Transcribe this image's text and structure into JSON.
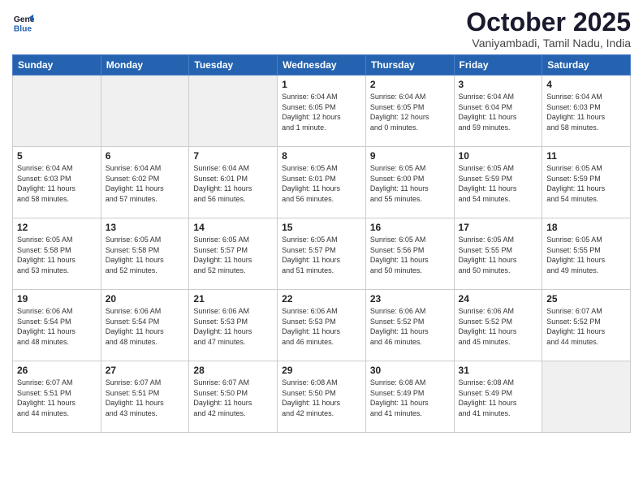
{
  "logo": {
    "line1": "General",
    "line2": "Blue"
  },
  "header": {
    "title": "October 2025",
    "subtitle": "Vaniyambadi, Tamil Nadu, India"
  },
  "weekdays": [
    "Sunday",
    "Monday",
    "Tuesday",
    "Wednesday",
    "Thursday",
    "Friday",
    "Saturday"
  ],
  "weeks": [
    [
      {
        "day": "",
        "info": "",
        "empty": true
      },
      {
        "day": "",
        "info": "",
        "empty": true
      },
      {
        "day": "",
        "info": "",
        "empty": true
      },
      {
        "day": "1",
        "info": "Sunrise: 6:04 AM\nSunset: 6:05 PM\nDaylight: 12 hours\nand 1 minute."
      },
      {
        "day": "2",
        "info": "Sunrise: 6:04 AM\nSunset: 6:05 PM\nDaylight: 12 hours\nand 0 minutes."
      },
      {
        "day": "3",
        "info": "Sunrise: 6:04 AM\nSunset: 6:04 PM\nDaylight: 11 hours\nand 59 minutes."
      },
      {
        "day": "4",
        "info": "Sunrise: 6:04 AM\nSunset: 6:03 PM\nDaylight: 11 hours\nand 58 minutes."
      }
    ],
    [
      {
        "day": "5",
        "info": "Sunrise: 6:04 AM\nSunset: 6:03 PM\nDaylight: 11 hours\nand 58 minutes."
      },
      {
        "day": "6",
        "info": "Sunrise: 6:04 AM\nSunset: 6:02 PM\nDaylight: 11 hours\nand 57 minutes."
      },
      {
        "day": "7",
        "info": "Sunrise: 6:04 AM\nSunset: 6:01 PM\nDaylight: 11 hours\nand 56 minutes."
      },
      {
        "day": "8",
        "info": "Sunrise: 6:05 AM\nSunset: 6:01 PM\nDaylight: 11 hours\nand 56 minutes."
      },
      {
        "day": "9",
        "info": "Sunrise: 6:05 AM\nSunset: 6:00 PM\nDaylight: 11 hours\nand 55 minutes."
      },
      {
        "day": "10",
        "info": "Sunrise: 6:05 AM\nSunset: 5:59 PM\nDaylight: 11 hours\nand 54 minutes."
      },
      {
        "day": "11",
        "info": "Sunrise: 6:05 AM\nSunset: 5:59 PM\nDaylight: 11 hours\nand 54 minutes."
      }
    ],
    [
      {
        "day": "12",
        "info": "Sunrise: 6:05 AM\nSunset: 5:58 PM\nDaylight: 11 hours\nand 53 minutes."
      },
      {
        "day": "13",
        "info": "Sunrise: 6:05 AM\nSunset: 5:58 PM\nDaylight: 11 hours\nand 52 minutes."
      },
      {
        "day": "14",
        "info": "Sunrise: 6:05 AM\nSunset: 5:57 PM\nDaylight: 11 hours\nand 52 minutes."
      },
      {
        "day": "15",
        "info": "Sunrise: 6:05 AM\nSunset: 5:57 PM\nDaylight: 11 hours\nand 51 minutes."
      },
      {
        "day": "16",
        "info": "Sunrise: 6:05 AM\nSunset: 5:56 PM\nDaylight: 11 hours\nand 50 minutes."
      },
      {
        "day": "17",
        "info": "Sunrise: 6:05 AM\nSunset: 5:55 PM\nDaylight: 11 hours\nand 50 minutes."
      },
      {
        "day": "18",
        "info": "Sunrise: 6:05 AM\nSunset: 5:55 PM\nDaylight: 11 hours\nand 49 minutes."
      }
    ],
    [
      {
        "day": "19",
        "info": "Sunrise: 6:06 AM\nSunset: 5:54 PM\nDaylight: 11 hours\nand 48 minutes."
      },
      {
        "day": "20",
        "info": "Sunrise: 6:06 AM\nSunset: 5:54 PM\nDaylight: 11 hours\nand 48 minutes."
      },
      {
        "day": "21",
        "info": "Sunrise: 6:06 AM\nSunset: 5:53 PM\nDaylight: 11 hours\nand 47 minutes."
      },
      {
        "day": "22",
        "info": "Sunrise: 6:06 AM\nSunset: 5:53 PM\nDaylight: 11 hours\nand 46 minutes."
      },
      {
        "day": "23",
        "info": "Sunrise: 6:06 AM\nSunset: 5:52 PM\nDaylight: 11 hours\nand 46 minutes."
      },
      {
        "day": "24",
        "info": "Sunrise: 6:06 AM\nSunset: 5:52 PM\nDaylight: 11 hours\nand 45 minutes."
      },
      {
        "day": "25",
        "info": "Sunrise: 6:07 AM\nSunset: 5:52 PM\nDaylight: 11 hours\nand 44 minutes."
      }
    ],
    [
      {
        "day": "26",
        "info": "Sunrise: 6:07 AM\nSunset: 5:51 PM\nDaylight: 11 hours\nand 44 minutes."
      },
      {
        "day": "27",
        "info": "Sunrise: 6:07 AM\nSunset: 5:51 PM\nDaylight: 11 hours\nand 43 minutes."
      },
      {
        "day": "28",
        "info": "Sunrise: 6:07 AM\nSunset: 5:50 PM\nDaylight: 11 hours\nand 42 minutes."
      },
      {
        "day": "29",
        "info": "Sunrise: 6:08 AM\nSunset: 5:50 PM\nDaylight: 11 hours\nand 42 minutes."
      },
      {
        "day": "30",
        "info": "Sunrise: 6:08 AM\nSunset: 5:49 PM\nDaylight: 11 hours\nand 41 minutes."
      },
      {
        "day": "31",
        "info": "Sunrise: 6:08 AM\nSunset: 5:49 PM\nDaylight: 11 hours\nand 41 minutes."
      },
      {
        "day": "",
        "info": "",
        "empty": true
      }
    ]
  ]
}
